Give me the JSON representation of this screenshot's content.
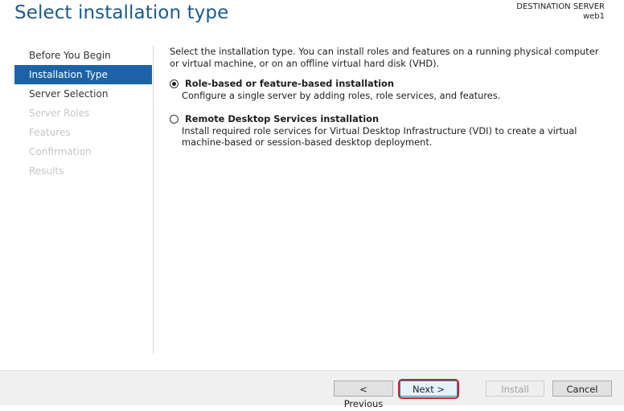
{
  "header": {
    "title": "Select installation type",
    "destination_label": "DESTINATION SERVER",
    "destination_server": "web1"
  },
  "sidebar": {
    "items": [
      {
        "label": "Before You Begin",
        "state": "enabled"
      },
      {
        "label": "Installation Type",
        "state": "active"
      },
      {
        "label": "Server Selection",
        "state": "enabled"
      },
      {
        "label": "Server Roles",
        "state": "disabled"
      },
      {
        "label": "Features",
        "state": "disabled"
      },
      {
        "label": "Confirmation",
        "state": "disabled"
      },
      {
        "label": "Results",
        "state": "disabled"
      }
    ]
  },
  "main": {
    "description": "Select the installation type. You can install roles and features on a running physical computer or virtual machine, or on an offline virtual hard disk (VHD).",
    "options": [
      {
        "label": "Role-based or feature-based installation",
        "description": "Configure a single server by adding roles, role services, and features.",
        "selected": true
      },
      {
        "label": "Remote Desktop Services installation",
        "description": "Install required role services for Virtual Desktop Infrastructure (VDI) to create a virtual machine-based or session-based desktop deployment.",
        "selected": false
      }
    ]
  },
  "footer": {
    "previous_label": "< Previous",
    "next_label": "Next >",
    "install_label": "Install",
    "cancel_label": "Cancel"
  },
  "colors": {
    "title": "#1e5a8c",
    "active_nav": "#1c63a6",
    "highlight_border": "#c0282e"
  }
}
